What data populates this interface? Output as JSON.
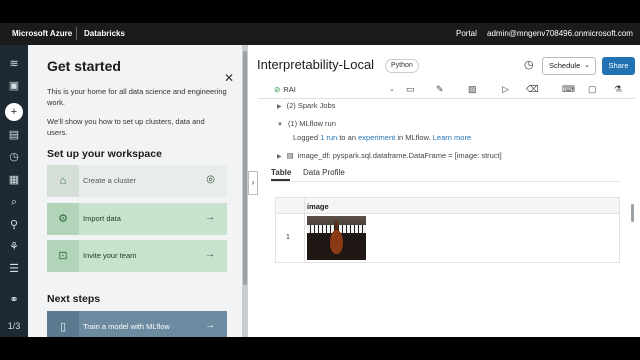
{
  "topbar": {
    "brand": "Microsoft Azure",
    "product": "Databricks",
    "portal": "Portal",
    "user": "admin@mngenv708496.onmicrosoft.com"
  },
  "rail": {
    "icons": [
      "layers-icon",
      "notebook-icon",
      "add-icon",
      "workspace-icon",
      "history-icon",
      "data-icon",
      "clusters-icon",
      "search-icon",
      "models-icon",
      "jobs-icon",
      "partner-icon"
    ],
    "counter": "1/3"
  },
  "get_started": {
    "title": "Get started",
    "intro": "This is your home for all data science and engineering work.",
    "intro2": "We'll show you how to set up clusters, data and users.",
    "setup_heading": "Set up your workspace",
    "cards": [
      {
        "label": "Create a cluster",
        "status": "done"
      },
      {
        "label": "Import data",
        "status": "todo"
      },
      {
        "label": "Invite your team",
        "status": "todo"
      }
    ],
    "next_heading": "Next steps",
    "next_cards": [
      {
        "label": "Train a model with MLflow"
      }
    ]
  },
  "notebook": {
    "title": "Interpretability-Local",
    "language": "Python",
    "schedule_label": "Schedule",
    "share_label": "Share",
    "cluster_name": "RAI"
  },
  "results": {
    "spark_jobs": "(2) Spark Jobs",
    "mlflow_run": "(1) MLflow run",
    "logged_prefix": "Logged",
    "logged_run": "1 run",
    "logged_mid": "to an",
    "logged_experiment": "experiment",
    "logged_suffix": "in MLflow.",
    "learn_more": "Learn more",
    "dataframe_line": "image_df:  pyspark.sql.dataframe.DataFrame = [image: struct]",
    "tabs": [
      "Table",
      "Data Profile"
    ],
    "table": {
      "column": "image",
      "rows": [
        {
          "index": "1"
        }
      ]
    }
  },
  "colors": {
    "accent": "#2272b4",
    "rail_bg": "#1e2a33",
    "topbar_bg": "#1b1b1b",
    "card_green": "#c9e2ce"
  }
}
